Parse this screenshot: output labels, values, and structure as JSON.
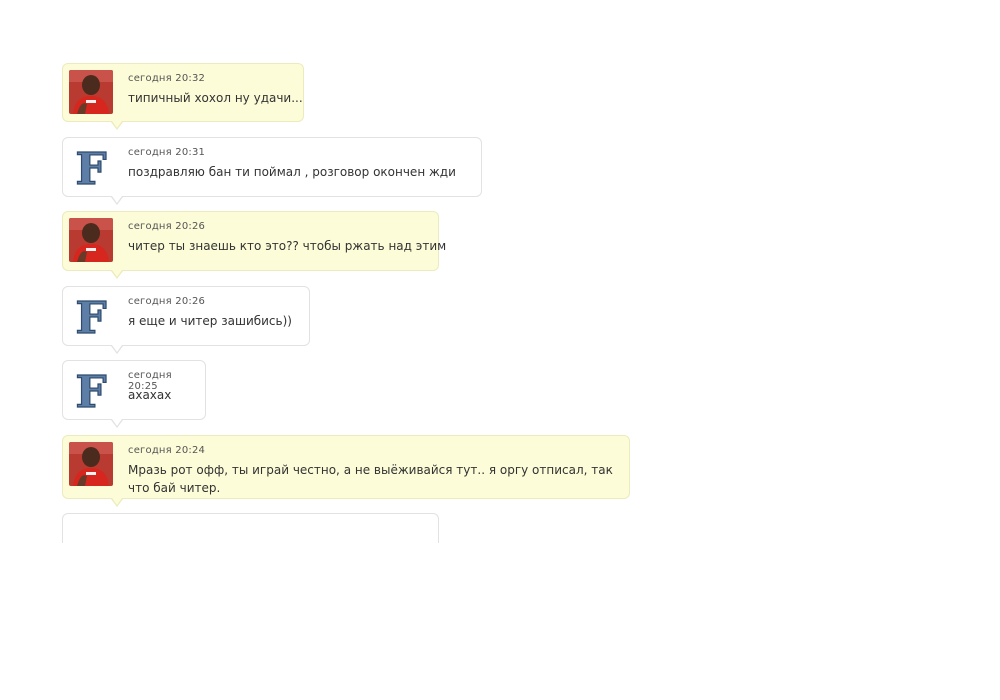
{
  "messages": [
    {
      "time": "сегодня 20:32",
      "text": "типичный хохол ну удачи...",
      "avatar": "player-photo-avatar",
      "bg": "#fcfcd8"
    },
    {
      "time": "сегодня 20:31",
      "text": "поздравляю бан ти поймал , розговор окончен жди",
      "avatar": "letter-f-avatar",
      "bg": "#ffffff"
    },
    {
      "time": "сегодня 20:26",
      "text": "читер ты знаешь кто это?? чтобы ржать над этим",
      "avatar": "player-photo-avatar",
      "bg": "#fcfcd8"
    },
    {
      "time": "сегодня 20:26",
      "text": "я еще и читер зашибись))",
      "avatar": "letter-f-avatar",
      "bg": "#ffffff"
    },
    {
      "time": "сегодня 20:25",
      "text": "ахахах",
      "avatar": "letter-f-avatar",
      "bg": "#ffffff"
    },
    {
      "time": "сегодня 20:24",
      "text": "Мразь рот офф, ты играй честно, а не выёживайся тут.. я оргу отписал, так что бай читер.",
      "avatar": "player-photo-avatar",
      "bg": "#fcfcd8"
    }
  ],
  "avatars": {
    "letter_f": "F"
  },
  "colors": {
    "own_bubble": "#fcfcd8",
    "other_bubble": "#ffffff",
    "border": "#e2e2e2"
  }
}
